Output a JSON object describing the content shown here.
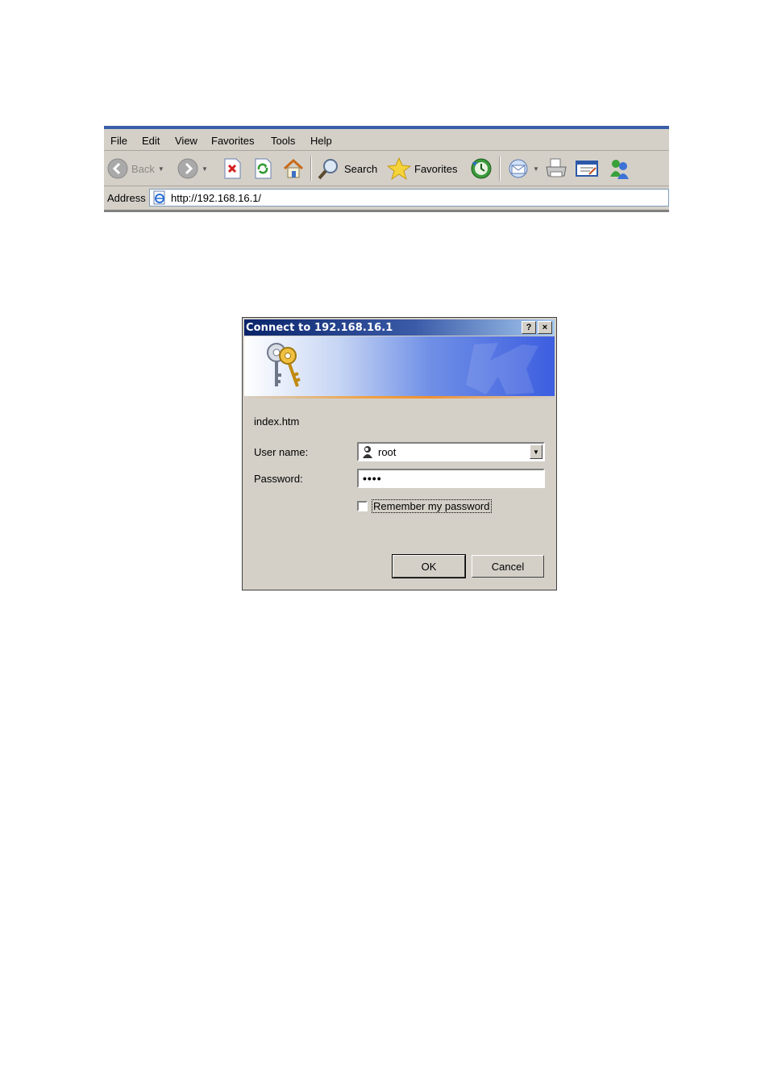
{
  "browser": {
    "menu": [
      {
        "label": "File"
      },
      {
        "label": "Edit"
      },
      {
        "label": "View"
      },
      {
        "label": "Favorites"
      },
      {
        "label": "Tools"
      },
      {
        "label": "Help"
      }
    ],
    "toolbar": {
      "back_label": "Back",
      "search_label": "Search",
      "favorites_label": "Favorites"
    },
    "address": {
      "label": "Address",
      "url": "http://192.168.16.1/"
    }
  },
  "dialog": {
    "title": "Connect to 192.168.16.1",
    "help_glyph": "?",
    "close_glyph": "×",
    "realm": "index.htm",
    "username_label": "User name:",
    "username_value": "root",
    "password_label": "Password:",
    "password_mask": "••••",
    "remember_label": "Remember my password",
    "remember_checked": false,
    "ok_label": "OK",
    "cancel_label": "Cancel"
  },
  "colors": {
    "title_bar_start": "#0a246a",
    "title_bar_end": "#a6caf0",
    "face": "#d4d0c8"
  }
}
